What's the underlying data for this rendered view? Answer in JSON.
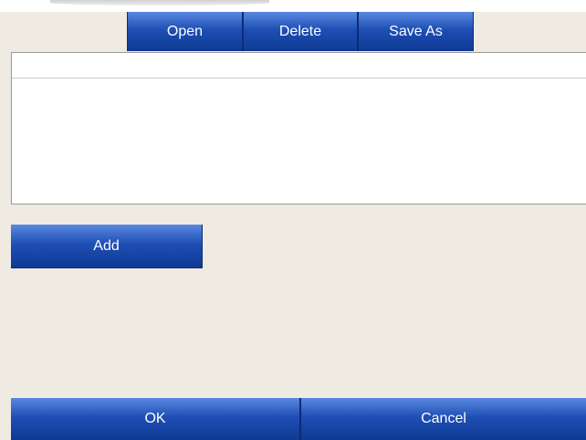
{
  "toolbar": {
    "open_label": "Open",
    "delete_label": "Delete",
    "save_as_label": "Save As"
  },
  "list": {
    "items": []
  },
  "actions": {
    "add_label": "Add"
  },
  "footer": {
    "ok_label": "OK",
    "cancel_label": "Cancel"
  }
}
